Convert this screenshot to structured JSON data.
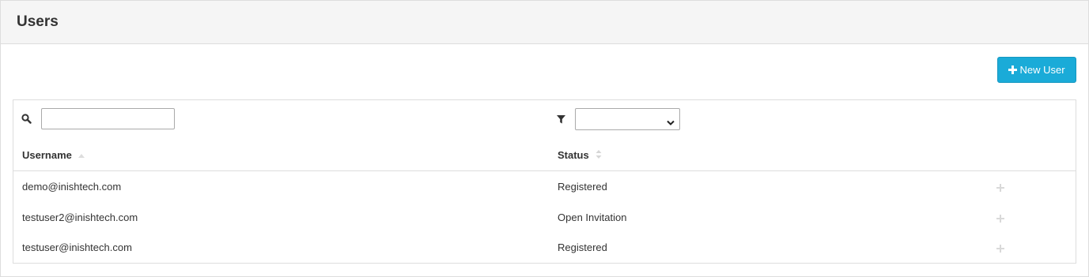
{
  "page": {
    "title": "Users",
    "new_user_label": "New User"
  },
  "grid": {
    "search": {
      "value": "",
      "placeholder": ""
    },
    "status_filter": {
      "selected": ""
    },
    "columns": [
      {
        "label": "Username",
        "sort": "ascending"
      },
      {
        "label": "Status",
        "sort": "none"
      }
    ],
    "rows": [
      {
        "username": "demo@inishtech.com",
        "status": "Registered"
      },
      {
        "username": "testuser2@inishtech.com",
        "status": "Open Invitation"
      },
      {
        "username": "testuser@inishtech.com",
        "status": "Registered"
      }
    ]
  },
  "colors": {
    "accent": "#1aabd8",
    "header_bg": "#f5f5f5",
    "border": "#dddddd"
  },
  "icons": [
    "plus-icon",
    "search-icon",
    "filter-icon",
    "chevron-down-icon",
    "sort-asc-icon",
    "sort-both-icon",
    "expand-row-icon"
  ]
}
